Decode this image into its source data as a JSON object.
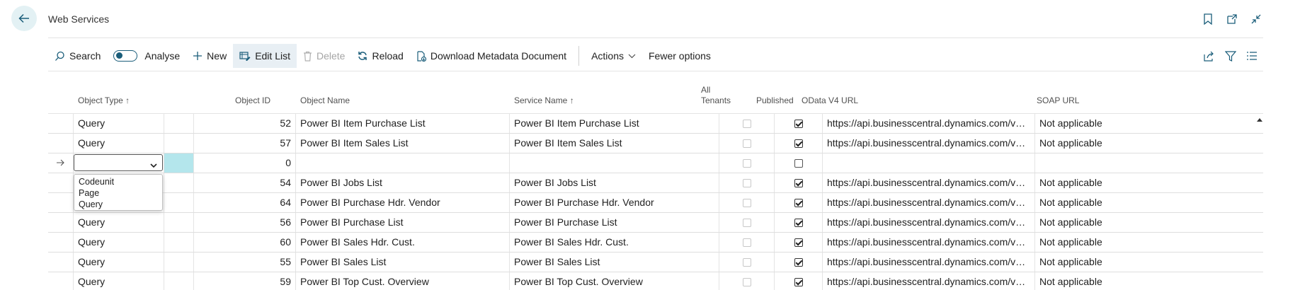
{
  "page": {
    "title": "Web Services"
  },
  "toolbar": {
    "search": "Search",
    "analyse": "Analyse",
    "new": "New",
    "edit_list": "Edit List",
    "delete": "Delete",
    "reload": "Reload",
    "download": "Download Metadata Document",
    "actions": "Actions",
    "fewer": "Fewer options"
  },
  "columns": {
    "object_type": "Object Type",
    "object_id": "Object ID",
    "object_name": "Object Name",
    "service_name": "Service Name",
    "all_tenants_1": "All",
    "all_tenants_2": "Tenants",
    "published": "Published",
    "odata": "OData V4 URL",
    "soap": "SOAP URL"
  },
  "rows": [
    {
      "type": "Query",
      "id": "52",
      "name": "Power BI Item Purchase List",
      "service": "Power BI Item Purchase List",
      "published": true,
      "odata": "https://api.businesscentral.dynamics.com/v2....",
      "soap": "Not applicable"
    },
    {
      "type": "Query",
      "id": "57",
      "name": "Power BI Item Sales List",
      "service": "Power BI Item Sales List",
      "published": true,
      "odata": "https://api.businesscentral.dynamics.com/v2....",
      "soap": "Not applicable"
    },
    {
      "type": "",
      "id": "0",
      "name": "",
      "service": "",
      "published": false,
      "odata": "",
      "soap": ""
    },
    {
      "type": "Query",
      "id": "54",
      "name": "Power BI Jobs List",
      "service": "Power BI Jobs List",
      "published": true,
      "odata": "https://api.businesscentral.dynamics.com/v2....",
      "soap": "Not applicable"
    },
    {
      "type": "Query",
      "id": "64",
      "name": "Power BI Purchase Hdr. Vendor",
      "service": "Power BI Purchase Hdr. Vendor",
      "published": true,
      "odata": "https://api.businesscentral.dynamics.com/v2....",
      "soap": "Not applicable"
    },
    {
      "type": "Query",
      "id": "56",
      "name": "Power BI Purchase List",
      "service": "Power BI Purchase List",
      "published": true,
      "odata": "https://api.businesscentral.dynamics.com/v2....",
      "soap": "Not applicable"
    },
    {
      "type": "Query",
      "id": "60",
      "name": "Power BI Sales Hdr. Cust.",
      "service": "Power BI Sales Hdr. Cust.",
      "published": true,
      "odata": "https://api.businesscentral.dynamics.com/v2....",
      "soap": "Not applicable"
    },
    {
      "type": "Query",
      "id": "55",
      "name": "Power BI Sales List",
      "service": "Power BI Sales List",
      "published": true,
      "odata": "https://api.businesscentral.dynamics.com/v2....",
      "soap": "Not applicable"
    },
    {
      "type": "Query",
      "id": "59",
      "name": "Power BI Top Cust. Overview",
      "service": "Power BI Top Cust. Overview",
      "published": true,
      "odata": "https://api.businesscentral.dynamics.com/v2....",
      "soap": "Not applicable"
    }
  ],
  "dropdown": {
    "options": [
      "Codeunit",
      "Page",
      "Query"
    ]
  },
  "colors": {
    "accent": "#1a5d7a",
    "selected_cell": "#b4e6ec",
    "back_button_bg": "#e3f1f4"
  }
}
